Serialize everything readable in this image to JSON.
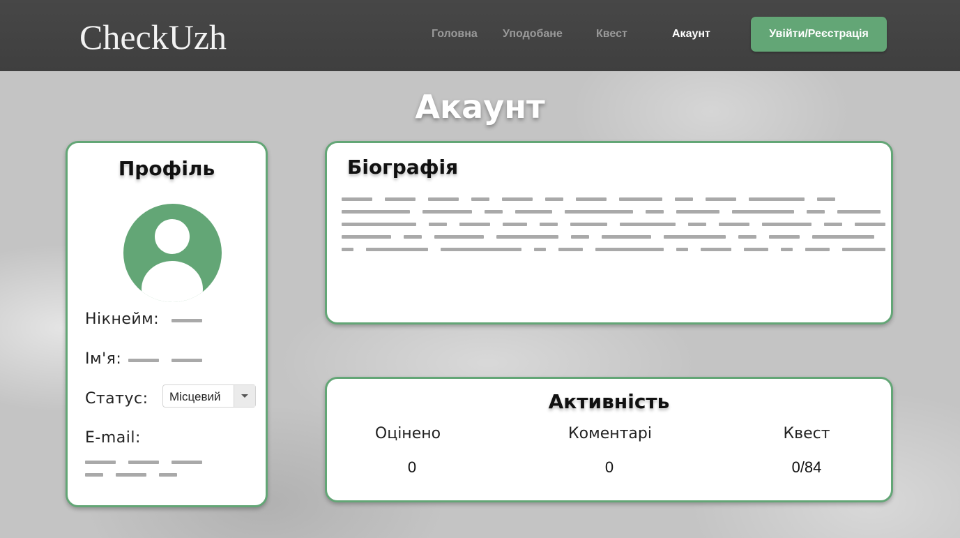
{
  "header": {
    "logo": "CheckUzh",
    "nav": [
      {
        "label": "Головна",
        "active": false
      },
      {
        "label": "Уподобане",
        "active": false
      },
      {
        "label": "Квест",
        "active": false
      },
      {
        "label": "Акаунт",
        "active": true
      }
    ],
    "login_button": "Увійти/Реєстрація"
  },
  "page": {
    "title": "Акаунт"
  },
  "profile": {
    "heading": "Профіль",
    "nickname_label": "Нікнейм:",
    "name_label": "Ім'я:",
    "status_label": "Статус:",
    "status_value": "Місцевий",
    "email_label": "E-mail:"
  },
  "bio": {
    "heading": "Біографія"
  },
  "activity": {
    "heading": "Активність",
    "stats": [
      {
        "label": "Оцінено",
        "value": "0"
      },
      {
        "label": "Коментарі",
        "value": "0"
      },
      {
        "label": "Квест",
        "value": "0/84"
      }
    ]
  },
  "colors": {
    "accent": "#63a676",
    "header_bg": "#444444",
    "placeholder_dash": "#a9a9a9"
  }
}
